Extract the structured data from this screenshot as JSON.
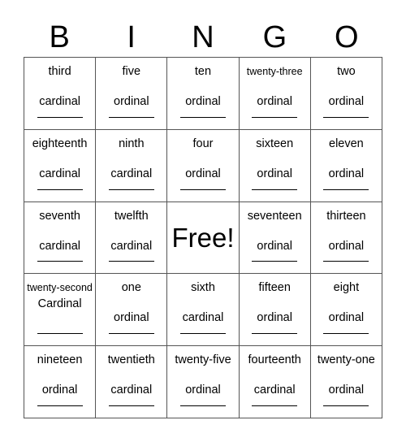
{
  "header": {
    "letters": [
      "B",
      "I",
      "N",
      "G",
      "O"
    ]
  },
  "grid": {
    "free_label": "Free!",
    "cells": [
      {
        "word": "third",
        "type": "cardinal"
      },
      {
        "word": "five",
        "type": "ordinal"
      },
      {
        "word": "ten",
        "type": "ordinal"
      },
      {
        "word": "twenty-three",
        "type": "ordinal"
      },
      {
        "word": "two",
        "type": "ordinal"
      },
      {
        "word": "eighteenth",
        "type": "cardinal"
      },
      {
        "word": "ninth",
        "type": "cardinal"
      },
      {
        "word": "four",
        "type": "ordinal"
      },
      {
        "word": "sixteen",
        "type": "ordinal"
      },
      {
        "word": "eleven",
        "type": "ordinal"
      },
      {
        "word": "seventh",
        "type": "cardinal"
      },
      {
        "word": "twelfth",
        "type": "cardinal"
      },
      {
        "word": "Free!",
        "type": ""
      },
      {
        "word": "seventeen",
        "type": "ordinal"
      },
      {
        "word": "thirteen",
        "type": "ordinal"
      },
      {
        "word": "twenty-second",
        "type": "Cardinal"
      },
      {
        "word": "one",
        "type": "ordinal"
      },
      {
        "word": "sixth",
        "type": "cardinal"
      },
      {
        "word": "fifteen",
        "type": "ordinal"
      },
      {
        "word": "eight",
        "type": "ordinal"
      },
      {
        "word": "nineteen",
        "type": "ordinal"
      },
      {
        "word": "twentieth",
        "type": "cardinal"
      },
      {
        "word": "twenty-five",
        "type": "ordinal"
      },
      {
        "word": "fourteenth",
        "type": "cardinal"
      },
      {
        "word": "twenty-one",
        "type": "ordinal"
      }
    ]
  },
  "style": {
    "border_color": "#555555",
    "text_color": "#000000",
    "background": "#ffffff"
  }
}
